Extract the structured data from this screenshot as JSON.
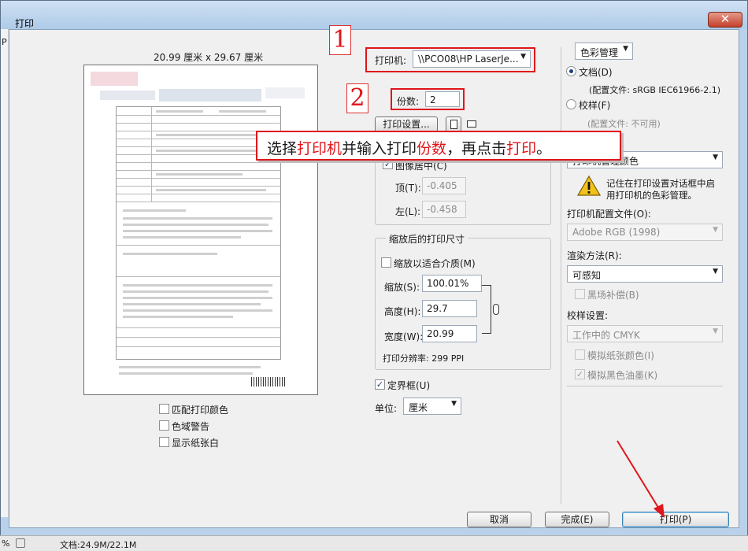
{
  "window": {
    "title": "打印",
    "close_glyph": "✕",
    "edge_letter": "P"
  },
  "preview": {
    "paper_size": "20.99 厘米 x 29.67 厘米",
    "options": [
      {
        "label": "匹配打印颜色",
        "checked": false
      },
      {
        "label": "色域警告",
        "checked": false
      },
      {
        "label": "显示纸张白",
        "checked": false
      }
    ]
  },
  "printer": {
    "label": "打印机:",
    "value": "\\\\PCO08\\HP LaserJe...",
    "copies_label": "份数:",
    "copies_value": "2",
    "setup_button": "打印设置..."
  },
  "position": {
    "center_label": "图像居中(C)",
    "center_checked": true,
    "top_label": "顶(T):",
    "top_value": "-0.405",
    "left_label": "左(L):",
    "left_value": "-0.458"
  },
  "scaled": {
    "group_title": "缩放后的打印尺寸",
    "fit_label": "缩放以适合介质(M)",
    "fit_checked": false,
    "scale_label": "缩放(S):",
    "scale_value": "100.01%",
    "height_label": "高度(H):",
    "height_value": "29.7",
    "width_label": "宽度(W):",
    "width_value": "20.99",
    "resolution": "打印分辨率: 299 PPI"
  },
  "bounding": {
    "label": "定界框(U)",
    "checked": true,
    "unit_label": "单位:",
    "unit_value": "厘米"
  },
  "color": {
    "mode": "色彩管理",
    "document_label": "文档(D)",
    "document_selected": true,
    "document_profile": "(配置文件: sRGB IEC61966-2.1)",
    "proof_label": "校样(F)",
    "proof_profile": "(配置文件: 不可用)",
    "handling_value": "打印机管理颜色",
    "warning": "记住在打印设置对话框中启用打印机的色彩管理。",
    "printer_profile_label": "打印机配置文件(O):",
    "printer_profile_value": "Adobe RGB (1998)",
    "intent_label": "渲染方法(R):",
    "intent_value": "可感知",
    "bpc_label": "黑场补偿(B)",
    "proof_setup_label": "校样设置:",
    "proof_setup_value": "工作中的 CMYK",
    "paper_color_label": "模拟纸张颜色(I)",
    "black_ink_label": "模拟黑色油墨(K)"
  },
  "buttons": {
    "cancel": "取消",
    "done": "完成(E)",
    "print": "打印(P)"
  },
  "annotation": {
    "step1": "1",
    "step2": "2",
    "callout_a": "选择",
    "callout_b": "打印机",
    "callout_c": "并输入打印",
    "callout_d": "份数",
    "callout_e": "，再点击",
    "callout_f": "打印",
    "callout_g": "。"
  },
  "status": {
    "zoom": "%",
    "doc": "文档:24.9M/22.1M"
  },
  "colors": {
    "annotation_red": "#e0151b",
    "window_blue": "#b9d1ea"
  }
}
